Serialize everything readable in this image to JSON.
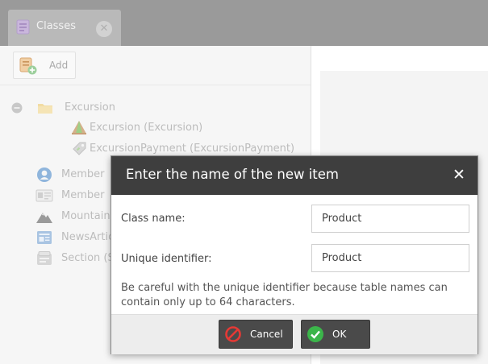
{
  "tab": {
    "label": "Classes",
    "icon": "class-list-icon",
    "close_icon": "close-icon"
  },
  "toolbar": {
    "add_label": "Add",
    "add_icon": "add-list-icon"
  },
  "tree": {
    "folder": {
      "label": "Excursion",
      "toggle_icon": "collapse-icon",
      "icon": "folder-icon"
    },
    "items": [
      {
        "label": "Excursion (Excursion)",
        "icon": "tent-icon"
      },
      {
        "label": "ExcursionPayment (ExcursionPayment)",
        "icon": "payment-tag-icon"
      },
      {
        "label": "Member",
        "icon": "user-icon"
      },
      {
        "label": "Member",
        "icon": "id-card-icon"
      },
      {
        "label": "Mountain",
        "icon": "mountain-icon"
      },
      {
        "label": "NewsArticle",
        "icon": "newspaper-icon"
      },
      {
        "label": "Section (Section)",
        "icon": "section-icon"
      }
    ]
  },
  "dialog": {
    "title": "Enter the name of the new item",
    "close_icon": "close-icon",
    "class_name_label": "Class name:",
    "class_name_value": "Product",
    "identifier_label": "Unique identifier:",
    "identifier_value": "Product",
    "note": "Be careful with the unique identifier because table names can contain only up to 64 characters.",
    "cancel_label": "Cancel",
    "cancel_icon": "cancel-icon",
    "ok_label": "OK",
    "ok_icon": "check-icon"
  },
  "colors": {
    "dialog_header": "#3e3e3e",
    "ok_green": "#3bb54a",
    "cancel_red": "#e53935",
    "tab_bar": "#9a9a9a"
  }
}
